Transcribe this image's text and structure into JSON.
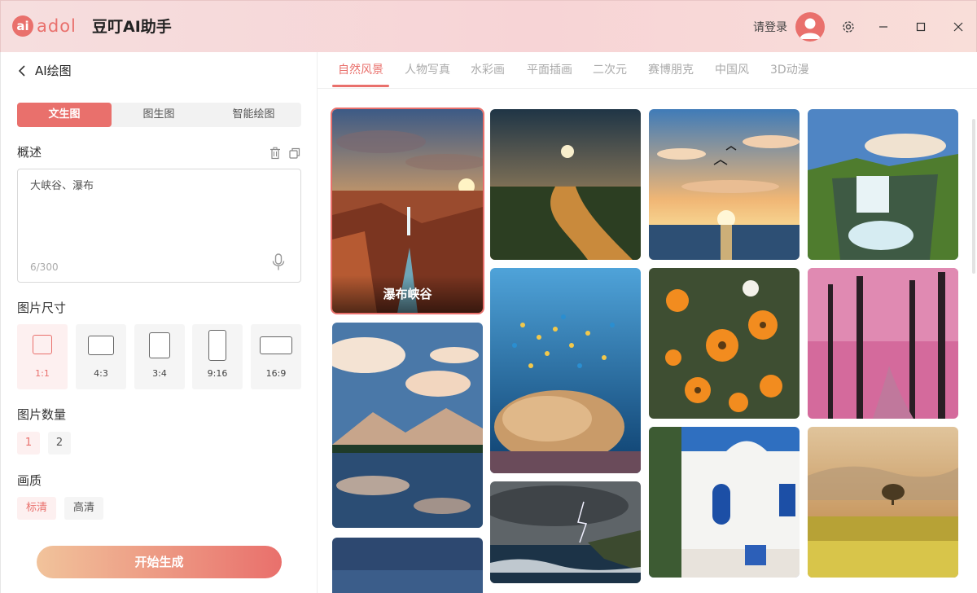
{
  "app": {
    "logo_mark": "ai",
    "logo_word": "adol",
    "title": "豆叮AI助手",
    "login_label": "请登录",
    "icons": {
      "settings": "gear-icon",
      "minimize": "minimize-icon",
      "maximize": "maximize-icon",
      "close": "close-icon",
      "avatar": "user-avatar-icon"
    }
  },
  "left": {
    "back_label": "AI绘图",
    "mode_tabs": [
      {
        "label": "文生图",
        "active": true
      },
      {
        "label": "图生图",
        "active": false
      },
      {
        "label": "智能绘图",
        "active": false
      }
    ],
    "prompt": {
      "label": "概述",
      "value": "大峡谷、瀑布",
      "count": "6/300",
      "icons": [
        "trash-icon",
        "copy-icon",
        "microphone-icon"
      ]
    },
    "size": {
      "label": "图片尺寸",
      "options": [
        {
          "label": "1:1",
          "active": true
        },
        {
          "label": "4:3",
          "active": false
        },
        {
          "label": "3:4",
          "active": false
        },
        {
          "label": "9:16",
          "active": false
        },
        {
          "label": "16:9",
          "active": false
        }
      ]
    },
    "count": {
      "label": "图片数量",
      "options": [
        {
          "label": "1",
          "active": true
        },
        {
          "label": "2",
          "active": false
        }
      ]
    },
    "quality": {
      "label": "画质",
      "options": [
        {
          "label": "标清",
          "active": true
        },
        {
          "label": "高清",
          "active": false
        }
      ]
    },
    "generate_label": "开始生成"
  },
  "right": {
    "categories": [
      {
        "label": "自然风景",
        "active": true
      },
      {
        "label": "人物写真",
        "active": false
      },
      {
        "label": "水彩画",
        "active": false
      },
      {
        "label": "平面插画",
        "active": false
      },
      {
        "label": "二次元",
        "active": false
      },
      {
        "label": "赛博朋克",
        "active": false
      },
      {
        "label": "中国风",
        "active": false
      },
      {
        "label": "3D动漫",
        "active": false
      }
    ],
    "gallery": {
      "selected_label": "瀑布峡谷",
      "tiles": [
        "canyon-waterfall-sunset",
        "mountain-lake-clouds",
        "twilight-lake",
        "moon-river",
        "coral-reef-fish",
        "storm-sea",
        "seagulls-sunset-sea",
        "orange-flowers",
        "white-blue-house",
        "cliff-waterfalls",
        "pink-forest",
        "golden-field-tree"
      ]
    },
    "colors": {
      "accent": "#e9706c",
      "inactive_tab": "#aaaaaa"
    }
  }
}
